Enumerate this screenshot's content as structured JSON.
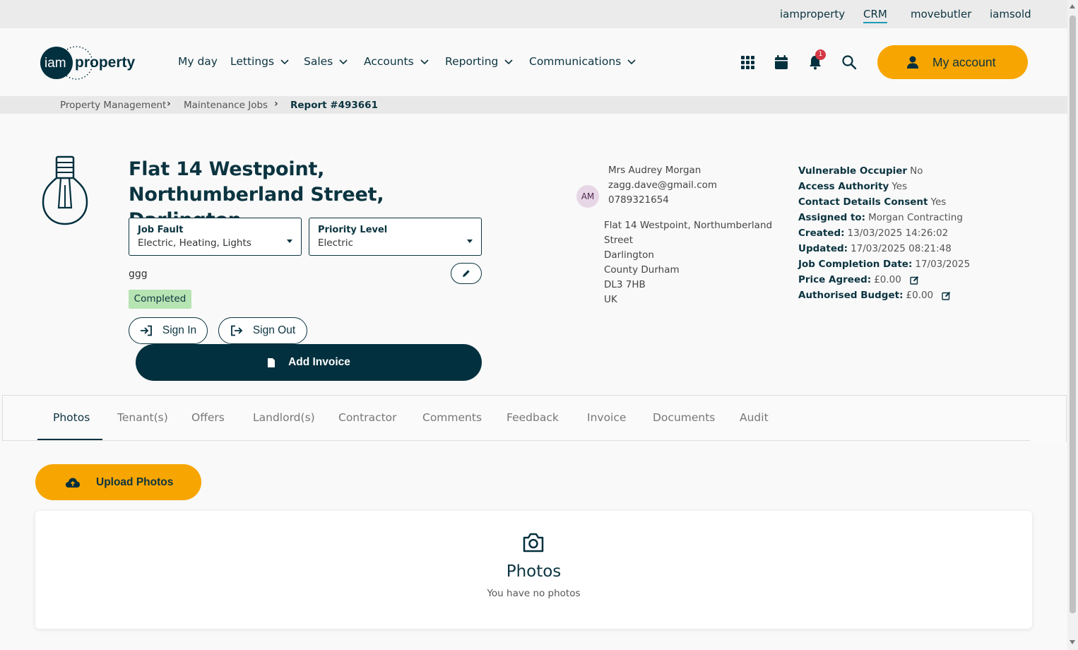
{
  "topbar": {
    "links": [
      "iamproperty",
      "CRM",
      "movebutler",
      "iamsold"
    ],
    "active": "CRM"
  },
  "header": {
    "logo_text": "iam property",
    "nav": [
      "My day",
      "Lettings",
      "Sales",
      "Accounts",
      "Reporting",
      "Communications"
    ],
    "icons": [
      "apps-grid-icon",
      "calendar-icon",
      "bell-icon",
      "search-icon"
    ],
    "notification_count": "1",
    "account_label": "My account"
  },
  "breadcrumb": [
    "Property Management",
    "Maintenance Jobs",
    "Report #493661"
  ],
  "job": {
    "title": "Flat 14 Westpoint, Northumberland Street, Darlington",
    "job_fault": {
      "label": "Job Fault",
      "value": "Electric, Heating, Lights"
    },
    "priority": {
      "label": "Priority Level",
      "value": "Electric"
    },
    "description": "ggg",
    "status": "Completed",
    "sign_in": "Sign In",
    "sign_out": "Sign Out",
    "add_invoice": "Add Invoice"
  },
  "tenant": {
    "initials": "AM",
    "name": "Mrs Audrey Morgan",
    "email": "zagg.dave@gmail.com",
    "phone": "0789321654",
    "address": [
      "Flat 14 Westpoint, Northumberland",
      "Street",
      "Darlington",
      "County Durham",
      "DL3 7HB",
      "UK"
    ]
  },
  "info": [
    {
      "label": "Vulnerable Occupier",
      "value": "No"
    },
    {
      "label": "Access Authority",
      "value": "Yes"
    },
    {
      "label": "Contact Details Consent",
      "value": "Yes"
    },
    {
      "label": "Assigned to:",
      "value": "Morgan Contracting"
    },
    {
      "label": "Created:",
      "value": "13/03/2025 14:26:02"
    },
    {
      "label": "Updated:",
      "value": "17/03/2025 08:21:48"
    },
    {
      "label": "Job Completion Date:",
      "value": "17/03/2025"
    },
    {
      "label": "Price Agreed:",
      "value": "£0.00"
    },
    {
      "label": "Authorised Budget:",
      "value": "£0.00"
    }
  ],
  "tabs": [
    "Photos",
    "Tenant(s)",
    "Offers",
    "Landlord(s)",
    "Contractor",
    "Comments",
    "Feedback",
    "Invoice",
    "Documents",
    "Audit"
  ],
  "active_tab": "Photos",
  "photos": {
    "upload_label": "Upload Photos",
    "title": "Photos",
    "empty_text": "You have no photos"
  },
  "colors": {
    "brand_dark": "#03303e",
    "accent_orange": "#f7a500",
    "status_green": "#b6e4b2",
    "notification_red": "#d53847"
  }
}
